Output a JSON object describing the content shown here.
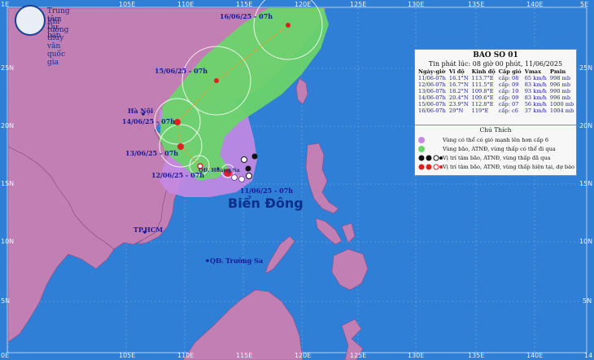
{
  "organization": {
    "line1": "Trung tâm Dự báo",
    "line2": "Khí tượng thủy văn quốc gia"
  },
  "grid": {
    "longitude_labels": [
      "105E",
      "110E",
      "115E",
      "120E",
      "125E",
      "130E",
      "135E",
      "140E"
    ],
    "latitude_labels": [
      "25N",
      "20N",
      "15N",
      "10N",
      "5N"
    ],
    "edge_labels": {
      "top_left": "1E",
      "top_right": "5E",
      "bottom_left": "0E",
      "bottom_right": "14"
    }
  },
  "bulletin": {
    "title": "BAO SO 01",
    "issued": "Tin phát lúc: 08 giờ 00 phút, 11/06/2025",
    "columns": [
      "Ngày-giờ",
      "Vĩ độ",
      "Kinh độ",
      "Cấp gió",
      "Vmax",
      "Pmin"
    ],
    "rows": [
      [
        "11/06-07h",
        "16.1°N",
        "113.7°E",
        "cấp: 08",
        "65 km/h",
        "998 mb"
      ],
      [
        "12/06-07h",
        "16.7°N",
        "111.5°E",
        "cấp: 09",
        "83 km/h",
        "996 mb"
      ],
      [
        "13/06-07h",
        "18.2°N",
        "109.8°E",
        "cấp: 10",
        "93 km/h",
        "990 mb"
      ],
      [
        "14/06-07h",
        "20.4°N",
        "109.6°E",
        "cấp: 09",
        "83 km/h",
        "996 mb"
      ],
      [
        "15/06-07h",
        "23.9°N",
        "112.8°E",
        "cấp: 07",
        "56 km/h",
        "1000 mb"
      ],
      [
        "16/06-07h",
        "29°N",
        "119°E",
        "cấp: c6",
        "37 km/h",
        "1004 mb"
      ]
    ]
  },
  "legend": {
    "title": "Chú Thích",
    "items": [
      {
        "text": "Vùng có thể có gió mạnh lên hơn cấp 6",
        "color": "#c58ae3"
      },
      {
        "text": "Vùng bão, ATNĐ, vùng thấp có thể đi qua",
        "color": "#6cd46a"
      },
      {
        "text": "Vị trí tâm bão, ATNĐ, vùng thấp đã qua",
        "color": "#111111"
      },
      {
        "text": "Vị trí tâm bão, ATNĐ, vùng thấp hiện tại, dự báo",
        "color": "#e02020"
      }
    ]
  },
  "track_labels": [
    {
      "text": "16/06/25 - 07h"
    },
    {
      "text": "15/06/25 - 07h"
    },
    {
      "text": "14/06/25 - 07h"
    },
    {
      "text": "13/06/25 - 07h"
    },
    {
      "text": "12/06/25 - 07h"
    },
    {
      "text": "11/06/25 - 07h"
    }
  ],
  "places": {
    "hanoi": "Hà Nội",
    "hcm": "TP.HCM",
    "truong_sa": "QĐ. Trường Sa",
    "hoang_sa": "QĐ. Hoàng Sa",
    "sea": "Biển Đông"
  },
  "colors": {
    "sea": "#2f7fd7",
    "land": "#c27fb4",
    "risk_zone": "#c58ae3",
    "cone": "#6cd46a",
    "track_line": "#f39a1e",
    "forecast_center": "#e02020",
    "past_center": "#111111"
  }
}
